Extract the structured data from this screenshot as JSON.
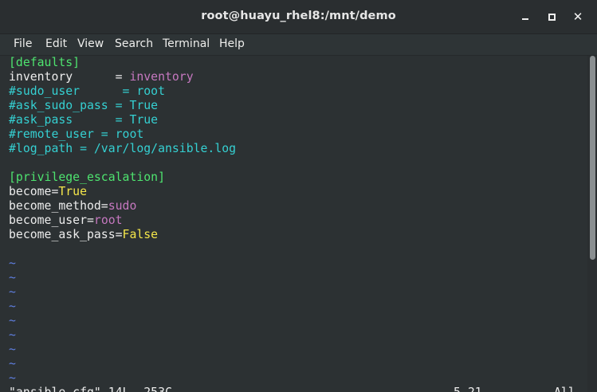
{
  "window": {
    "title": "root@huayu_rhel8:/mnt/demo",
    "buttons": {
      "minimize": "minimize-icon",
      "maximize": "maximize-icon",
      "close": "✕"
    }
  },
  "menu": {
    "file": "File",
    "edit": "Edit",
    "view": "View",
    "search": "Search",
    "terminal": "Terminal",
    "help": "Help"
  },
  "editor": {
    "lines": [
      {
        "section": "[defaults]"
      },
      {
        "key": "inventory      = ",
        "val": "inventory"
      },
      {
        "comment": "#sudo_user      = root"
      },
      {
        "comment": "#ask_sudo_pass = True"
      },
      {
        "comment": "#ask_pass      = True"
      },
      {
        "comment": "#remote_user = root"
      },
      {
        "comment": "#log_path = /var/log/ansible.log"
      },
      {
        "blank": ""
      },
      {
        "section": "[privilege_escalation]"
      },
      {
        "key": "become=",
        "bool": "True"
      },
      {
        "key": "become_method=",
        "val": "sudo"
      },
      {
        "key": "become_user=",
        "val": "root"
      },
      {
        "key": "become_ask_pass=",
        "bool": "False"
      },
      {
        "blank": ""
      },
      {
        "tilde": "~"
      },
      {
        "tilde": "~"
      },
      {
        "tilde": "~"
      },
      {
        "tilde": "~"
      },
      {
        "tilde": "~"
      },
      {
        "tilde": "~"
      },
      {
        "tilde": "~"
      },
      {
        "tilde": "~"
      },
      {
        "tilde": "~"
      }
    ],
    "status": {
      "file": "\"ansible.cfg\" 14L, 253C",
      "position": "5,21",
      "scroll": "All"
    }
  },
  "colors": {
    "section": "#4ee46f",
    "comment": "#35d0d2",
    "value": "#c678c0",
    "boolean": "#f4e64a",
    "tilde": "#5f7fe0",
    "background": "#2c3133"
  }
}
